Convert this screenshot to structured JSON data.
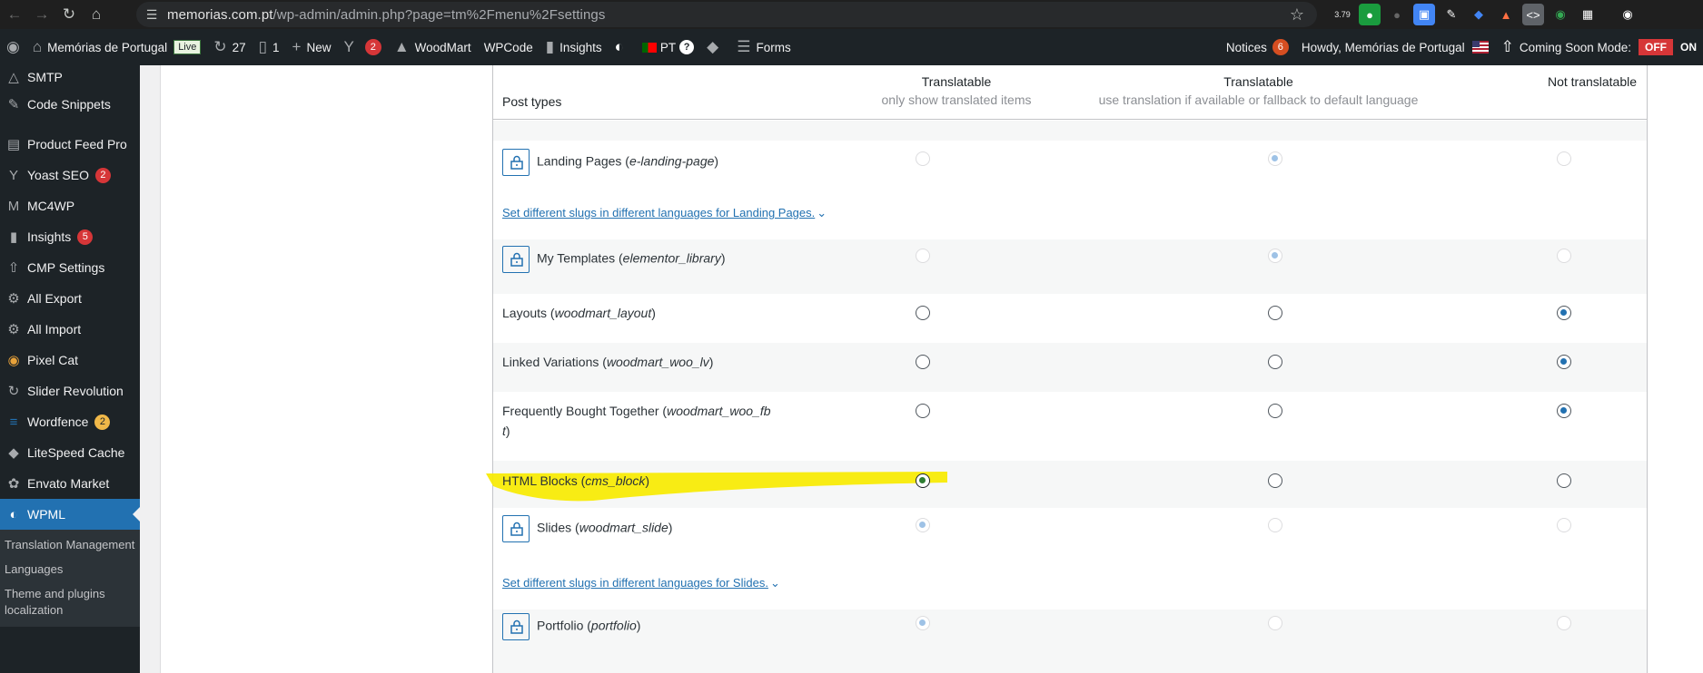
{
  "browser": {
    "url_host": "memorias.com.pt",
    "url_path": "/wp-admin/admin.php?page=tm%2Fmenu%2Fsettings",
    "ext_badge": "3.79"
  },
  "adminbar": {
    "site_name": "Memórias de Portugal",
    "live_label": "Live",
    "updates_count": "27",
    "comments_count": "1",
    "new_label": "New",
    "yoast_count": "2",
    "woodmart": "WoodMart",
    "wpcode": "WPCode",
    "insights": "Insights",
    "lang_code": "PT",
    "lang_help": "?",
    "forms": "Forms",
    "notices": "Notices",
    "notices_count": "6",
    "howdy": "Howdy, Memórias de Portugal",
    "coming_soon": "Coming Soon Mode:",
    "coming_soon_state": "OFF",
    "on_text": "ON"
  },
  "sidebar": {
    "items": [
      {
        "label": "SMTP",
        "icon": "smtp-icon"
      },
      {
        "label": "Code Snippets",
        "icon": "code-snippets-icon"
      },
      {
        "label": "Product Feed Pro",
        "icon": "feed-icon"
      },
      {
        "label": "Yoast SEO",
        "icon": "yoast-icon",
        "badge": "2"
      },
      {
        "label": "MC4WP",
        "icon": "mc4wp-icon"
      },
      {
        "label": "Insights",
        "icon": "insights-icon",
        "badge": "5"
      },
      {
        "label": "CMP Settings",
        "icon": "rocket-icon"
      },
      {
        "label": "All Export",
        "icon": "export-icon"
      },
      {
        "label": "All Import",
        "icon": "import-icon"
      },
      {
        "label": "Pixel Cat",
        "icon": "cat-icon"
      },
      {
        "label": "Slider Revolution",
        "icon": "slider-icon"
      },
      {
        "label": "Wordfence",
        "icon": "wordfence-icon",
        "badge": "2"
      },
      {
        "label": "LiteSpeed Cache",
        "icon": "litespeed-icon"
      },
      {
        "label": "Envato Market",
        "icon": "envato-icon"
      },
      {
        "label": "WPML",
        "icon": "wpml-icon"
      }
    ],
    "submenu": [
      "Translation Management",
      "Languages",
      "Theme and plugins localization"
    ]
  },
  "table": {
    "col_post_types": "Post types",
    "col1_title": "Translatable",
    "col1_sub": "only show translated items",
    "col2_title": "Translatable",
    "col2_sub": "use translation if available or fallback to default language",
    "col3_title": "Not translatable",
    "rows": [
      {
        "name": "Landing Pages",
        "slug": "e-landing-page",
        "selected": 2,
        "locked": true
      },
      {
        "name": "My Templates",
        "slug": "elementor_library",
        "selected": 2,
        "locked": true
      },
      {
        "name": "Layouts",
        "slug": "woodmart_layout",
        "selected": 3,
        "locked": false
      },
      {
        "name": "Linked Variations",
        "slug": "woodmart_woo_lv",
        "selected": 3,
        "locked": false
      },
      {
        "name": "Frequently Bought Together",
        "slug_line1": "woodmart_woo_fb",
        "slug_line2": "t",
        "selected": 3,
        "locked": false
      },
      {
        "name": "HTML Blocks",
        "slug": "cms_block",
        "selected": 1,
        "locked": false
      },
      {
        "name": "Slides",
        "slug": "woodmart_slide",
        "selected": 1,
        "locked": true
      },
      {
        "name": "Portfolio",
        "slug": "portfolio",
        "selected": 1,
        "locked": true
      }
    ],
    "slug_link_landing": "Set different slugs in different languages for Landing Pages.",
    "slug_link_slides": "Set different slugs in different languages for Slides."
  },
  "colors": {
    "accent": "#2271b1",
    "highlight": "#f5e600",
    "adminbar": "#1d2327"
  }
}
